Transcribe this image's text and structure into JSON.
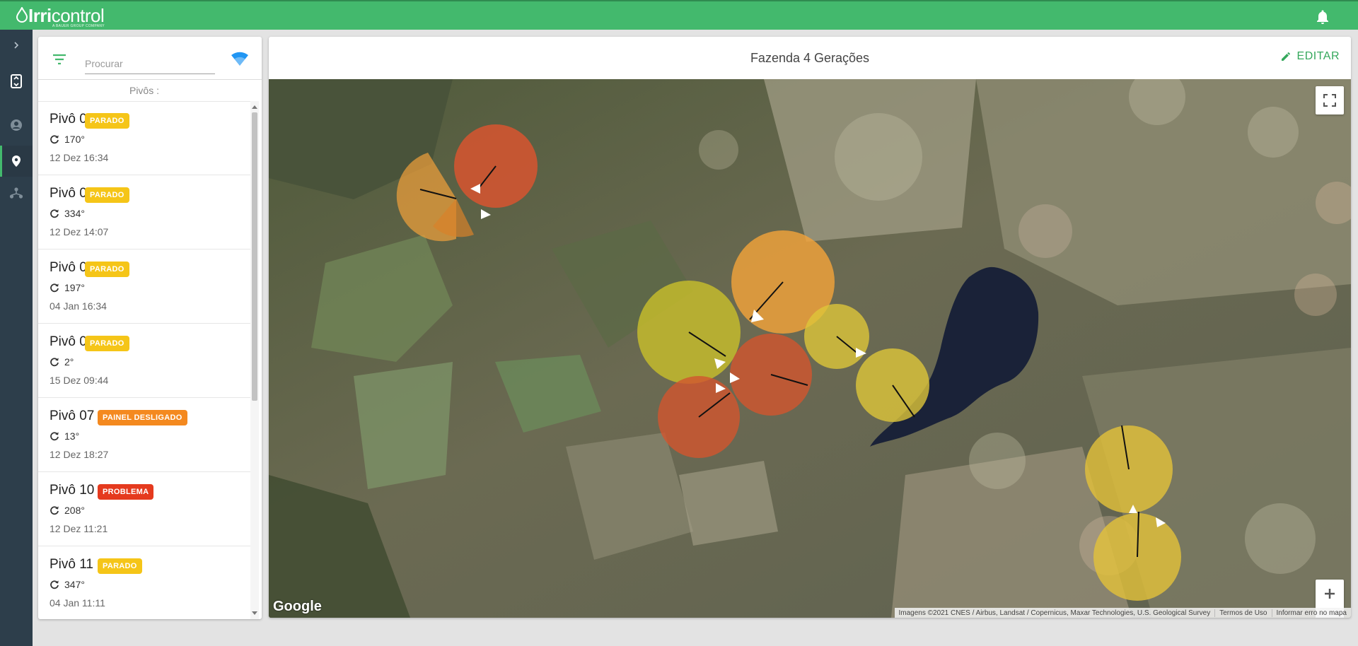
{
  "app": {
    "logo_text": "Irricontrol",
    "logo_bold": "Irri",
    "logo_light": "control",
    "logo_tagline": "A BAUER GROUP COMPANY"
  },
  "sidebar": {
    "items": [
      {
        "icon": "chevron-right-icon",
        "active": false
      },
      {
        "icon": "farm-switch-icon",
        "active": false
      },
      {
        "icon": "user-icon",
        "active": false
      },
      {
        "icon": "map-pin-icon",
        "active": true
      },
      {
        "icon": "network-icon",
        "active": false
      }
    ]
  },
  "search": {
    "placeholder": "Procurar",
    "value": ""
  },
  "list": {
    "header": "Pivôs :",
    "pivots": [
      {
        "name": "Pivô 01",
        "status": "PARADO",
        "status_color": "#f5c518",
        "angle": "170°",
        "date": "12 Dez 16:34"
      },
      {
        "name": "Pivô 02",
        "status": "PARADO",
        "status_color": "#f5c518",
        "angle": "334°",
        "date": "12 Dez 14:07"
      },
      {
        "name": "Pivô 05",
        "status": "PARADO",
        "status_color": "#f5c518",
        "angle": "197°",
        "date": "04 Jan 16:34"
      },
      {
        "name": "Pivô 06",
        "status": "PARADO",
        "status_color": "#f5c518",
        "angle": "2°",
        "date": "15 Dez 09:44"
      },
      {
        "name": "Pivô 07",
        "status": "PAINEL DESLIGADO",
        "status_color": "#f4891f",
        "angle": "13°",
        "date": "12 Dez 18:27"
      },
      {
        "name": "Pivô 10",
        "status": "PROBLEMA",
        "status_color": "#e53a1e",
        "angle": "208°",
        "date": "12 Dez 11:21"
      },
      {
        "name": "Pivô 11",
        "status": "PARADO",
        "status_color": "#f5c518",
        "angle": "347°",
        "date": "04 Jan 11:11"
      }
    ]
  },
  "map": {
    "title": "Fazenda 4 Gerações",
    "edit_label": "EDITAR",
    "google_label": "Google",
    "attribution": "Imagens ©2021 CNES / Airbus, Landsat / Copernicus, Maxar Technologies, U.S. Geological Survey",
    "terms": "Termos de Uso",
    "report": "Informar erro no mapa",
    "zoom_in": "+",
    "zoom_out": "−"
  },
  "colors": {
    "brand_green": "#43b96d",
    "rail": "#2d3e4b",
    "parado": "#f5c518",
    "painel_desligado": "#f4891f",
    "problema": "#e53a1e"
  }
}
